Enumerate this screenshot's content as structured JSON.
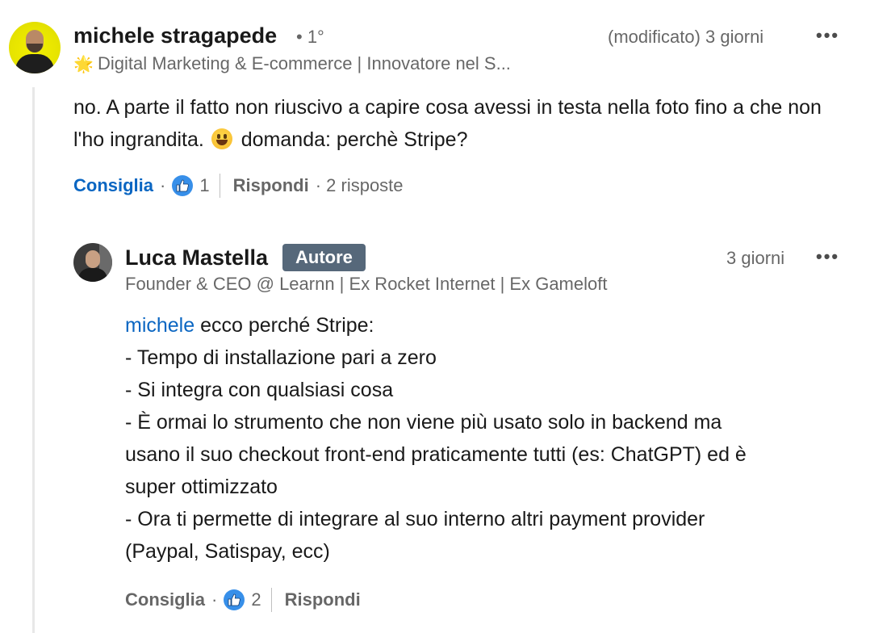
{
  "comment": {
    "author": "michele stragapede",
    "degree": "• 1°",
    "edited_time": "(modificato) 3 giorni",
    "menu": "•••",
    "headline_icon": "🌟",
    "headline": "Digital Marketing & E-commerce | Innovatore nel S...",
    "text_part1": "no. A parte il fatto non riuscivo a capire cosa avessi in testa nella foto fino a che non l'ho ingrandita.",
    "emoji": "grinning-face-emoji",
    "text_part2": "domanda: perchè Stripe?",
    "actions": {
      "like_label": "Consiglia",
      "dot": "·",
      "reaction_count": "1",
      "reply_label": "Rispondi",
      "replies": "· 2 risposte"
    }
  },
  "reply": {
    "author": "Luca Mastella",
    "badge": "Autore",
    "time": "3 giorni",
    "menu": "•••",
    "headline": "Founder & CEO @ Learnn | Ex Rocket Internet | Ex Gameloft",
    "mention": "michele",
    "line1_rest": " ecco perché Stripe:",
    "lines": [
      "- Tempo di installazione pari a zero",
      "- Si integra con qualsiasi cosa",
      "- È ormai lo strumento che non viene più usato solo in backend ma",
      "usano il suo checkout front-end praticamente tutti (es: ChatGPT) ed è",
      "super ottimizzato",
      "- Ora ti permette di integrare al suo interno altri payment provider",
      "(Paypal, Satispay, ecc)"
    ],
    "actions": {
      "like_label": "Consiglia",
      "dot": "·",
      "reaction_count": "2",
      "reply_label": "Rispondi"
    }
  },
  "colors": {
    "link_blue": "#0a66c2",
    "badge_bg": "#56687a",
    "like_blue": "#378fe9"
  }
}
